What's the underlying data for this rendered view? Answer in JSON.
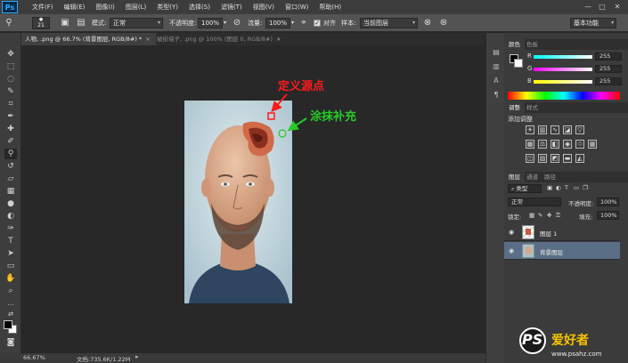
{
  "app": {
    "logo": "Ps"
  },
  "menu": [
    "文件(F)",
    "编辑(E)",
    "图像(I)",
    "图层(L)",
    "类型(Y)",
    "选择(S)",
    "滤镜(T)",
    "视图(V)",
    "窗口(W)",
    "帮助(H)"
  ],
  "window_controls": [
    "—",
    "□",
    "✕"
  ],
  "options": {
    "brush_size": "21",
    "mode_label": "模式:",
    "mode_value": "正常",
    "opacity_label": "不透明度:",
    "opacity_value": "100%",
    "flow_label": "流量:",
    "flow_value": "100%",
    "aligned_label": "对齐",
    "sample_label": "样本:",
    "sample_value": "当前图层",
    "workspace": "基本功能"
  },
  "tabs": [
    {
      "label": "人物, .png @ 66.7% (背景图层, RGB/8#) *",
      "active": true
    },
    {
      "label": "破损墙子, .png @ 100% (图层 0, RGB/8#)",
      "active": false
    }
  ],
  "annotations": {
    "source_point": "定义源点",
    "paint_fill": "涂抹补充"
  },
  "colors": {
    "annotation_red": "#ff1a1a",
    "annotation_green": "#28c828",
    "selected_layer": "#5a6e85"
  },
  "status": {
    "zoom": "66.67%",
    "doc": "文档:735.6K/1.22M"
  },
  "color_panel": {
    "tabs": [
      "颜色",
      "色板"
    ],
    "channels": [
      {
        "label": "R",
        "value": "255"
      },
      {
        "label": "G",
        "value": "255"
      },
      {
        "label": "B",
        "value": "255"
      }
    ]
  },
  "adjust_panel": {
    "tabs": [
      "调整",
      "样式"
    ],
    "title": "添加调整"
  },
  "layers_panel": {
    "tabs": [
      "图层",
      "通道",
      "路径"
    ],
    "filter": "类型",
    "blend": "正常",
    "opacity_label": "不透明度:",
    "opacity_value": "100%",
    "lock_label": "锁定:",
    "fill_label": "填充:",
    "fill_value": "100%",
    "layers": [
      {
        "name": "图层 1",
        "selected": false
      },
      {
        "name": "背景图层",
        "selected": true
      }
    ]
  },
  "watermark": {
    "logo": "PS",
    "text": "爱好者",
    "url": "www.psahz.com"
  }
}
